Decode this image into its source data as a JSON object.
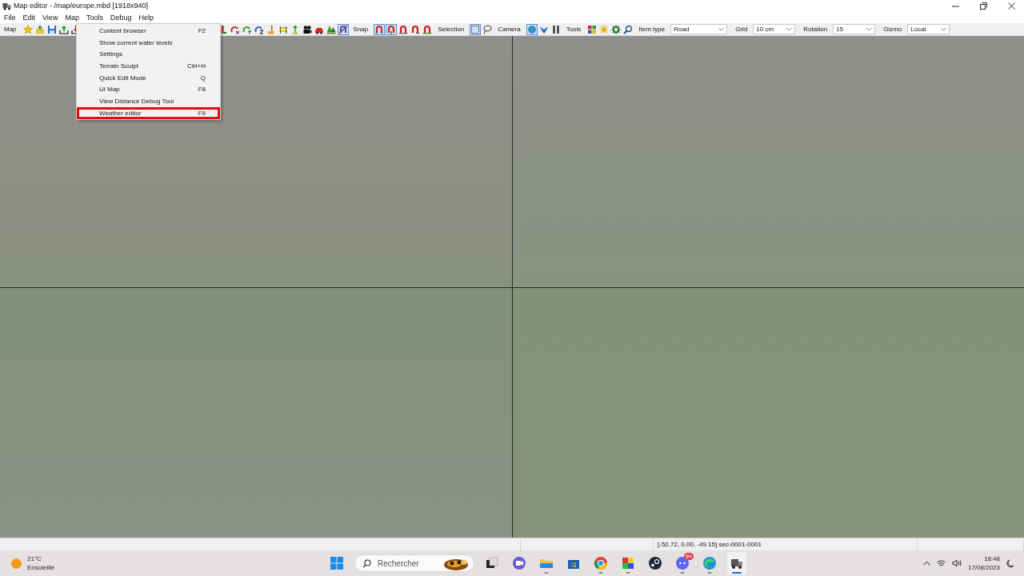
{
  "window": {
    "title": "Map editor - /map/europe.mbd [1918x940]"
  },
  "menu_bar": [
    "File",
    "Edit",
    "View",
    "Map",
    "Tools",
    "Debug",
    "Help"
  ],
  "tools_menu": [
    {
      "label": "Content browser",
      "shortcut": "F2",
      "highlighted": false
    },
    {
      "label": "Show current water levels",
      "highlighted": false
    },
    {
      "label": "Settings",
      "highlighted": false
    },
    {
      "label": "Terrain Sculpt",
      "shortcut": "Ctrl+H",
      "highlighted": false
    },
    {
      "label": "Quick Edit Mode",
      "shortcut": "Q",
      "highlighted": false
    },
    {
      "label": "UI Map",
      "shortcut": "F8",
      "highlighted": false
    },
    {
      "label": "View Distance Debug Tool",
      "highlighted": false
    },
    {
      "label": "Weather editor",
      "shortcut": "F9",
      "highlighted": true
    }
  ],
  "toolbar": {
    "left": [
      {
        "kind": "label",
        "text": "Map"
      },
      {
        "kind": "icon",
        "pressed": false
      },
      {
        "kind": "icon",
        "pressed": false
      },
      {
        "kind": "icon",
        "pressed": false
      },
      {
        "kind": "icon",
        "pressed": false
      },
      {
        "kind": "icon",
        "pressed": false
      }
    ],
    "right": [
      {
        "kind": "icon",
        "pressed": false
      },
      {
        "kind": "icon",
        "pressed": false
      },
      {
        "kind": "icon",
        "pressed": false
      },
      {
        "kind": "icon",
        "pressed": false
      },
      {
        "kind": "icon",
        "pressed": false
      },
      {
        "kind": "icon",
        "pressed": false
      },
      {
        "kind": "icon",
        "pressed": false
      },
      {
        "kind": "icon",
        "pressed": false
      },
      {
        "kind": "icon",
        "pressed": false
      },
      {
        "kind": "icon",
        "pressed": false
      },
      {
        "kind": "icon",
        "pressed": true
      },
      {
        "kind": "label",
        "text": "Snap"
      },
      {
        "kind": "icon",
        "pressed": true
      },
      {
        "kind": "icon",
        "pressed": true
      },
      {
        "kind": "icon",
        "pressed": false
      },
      {
        "kind": "icon",
        "pressed": false
      },
      {
        "kind": "icon",
        "pressed": false
      },
      {
        "kind": "label",
        "text": "Selection"
      },
      {
        "kind": "icon",
        "pressed": true
      },
      {
        "kind": "icon",
        "pressed": false
      },
      {
        "kind": "label",
        "text": "Camera"
      },
      {
        "kind": "icon",
        "pressed": true
      },
      {
        "kind": "icon",
        "pressed": false
      },
      {
        "kind": "icon",
        "pressed": false
      },
      {
        "kind": "label",
        "text": "Tools"
      },
      {
        "kind": "icon",
        "pressed": false
      },
      {
        "kind": "icon",
        "pressed": false
      },
      {
        "kind": "icon",
        "pressed": false
      },
      {
        "kind": "icon",
        "pressed": false
      },
      {
        "kind": "label",
        "text": "Item type"
      },
      {
        "kind": "select",
        "value": "Road",
        "wide": true
      },
      {
        "kind": "label",
        "text": "Grid"
      },
      {
        "kind": "select",
        "value": "10 cm",
        "wide": false
      },
      {
        "kind": "label",
        "text": "Rotation"
      },
      {
        "kind": "select",
        "value": "15",
        "wide": false
      },
      {
        "kind": "label",
        "text": "Gizmo"
      },
      {
        "kind": "select",
        "value": "Local",
        "wide": false
      }
    ]
  },
  "status_bar": {
    "position": "[-52.72, 0.00, -49.15] sec-0001-0001"
  },
  "taskbar": {
    "weather": {
      "temperature": "21°C",
      "condition": "Ensoleillé"
    },
    "search": {
      "placeholder": "Rechercher"
    },
    "apps": [
      {
        "running": false,
        "active": false
      },
      {
        "running": false,
        "active": false
      },
      {
        "running": true,
        "active": false
      },
      {
        "running": false,
        "active": false
      },
      {
        "running": true,
        "active": false
      },
      {
        "running": true,
        "active": false
      },
      {
        "running": false,
        "active": false
      },
      {
        "running": true,
        "active": false,
        "badge": "9+"
      },
      {
        "running": true,
        "active": false
      },
      {
        "running": true,
        "active": true
      }
    ],
    "clock": {
      "time": "18:48",
      "date": "17/08/2023"
    }
  }
}
